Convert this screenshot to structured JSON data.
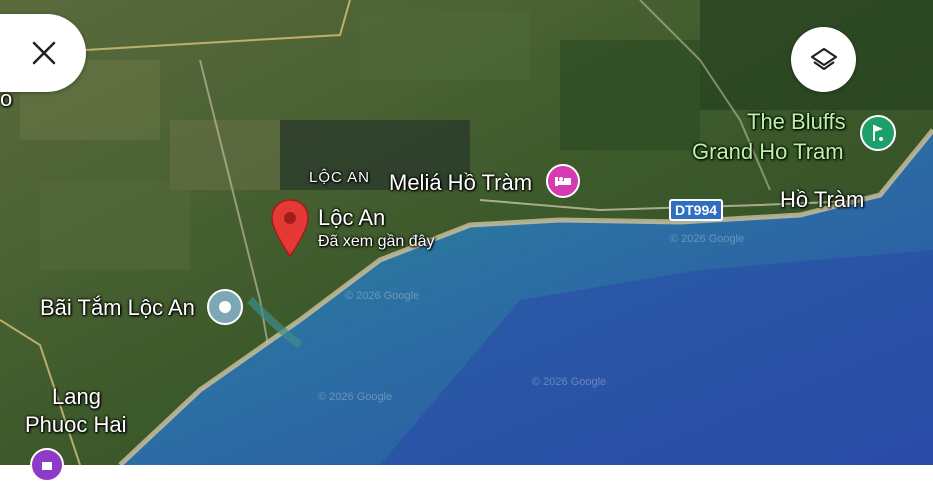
{
  "map": {
    "labels": {
      "loc_an_area": "LỘC AN",
      "melia": "Meliá Hồ Tràm",
      "bluffs_line1": "The Bluffs",
      "bluffs_line2": "Grand Ho Tram",
      "ho_tram": "Hồ Tràm",
      "loc_an_pin": "Lộc An",
      "pin_subtitle": "Đã xem gần đây",
      "bai_tam": "Bãi Tắm Lộc An",
      "lang_line1": "Lang",
      "lang_line2": "Phuoc Hai",
      "o_partial": "o"
    },
    "road_shield": "DT994",
    "watermarks": [
      "© 2026 Google",
      "© 2026 Google",
      "© 2026 Google",
      "© 2026 Google"
    ]
  },
  "controls": {
    "close_icon": "close-icon",
    "layers_icon": "layers-icon"
  },
  "colors": {
    "pin": "#e53935",
    "hotel_poi": "#d63ab2",
    "golf_poi": "#1e9e6a",
    "beach_poi": "#7ea7b6",
    "ocean_deep": "#2c56a8",
    "ocean_shallow": "#2e8a8f",
    "land": "#3f5a2e"
  }
}
